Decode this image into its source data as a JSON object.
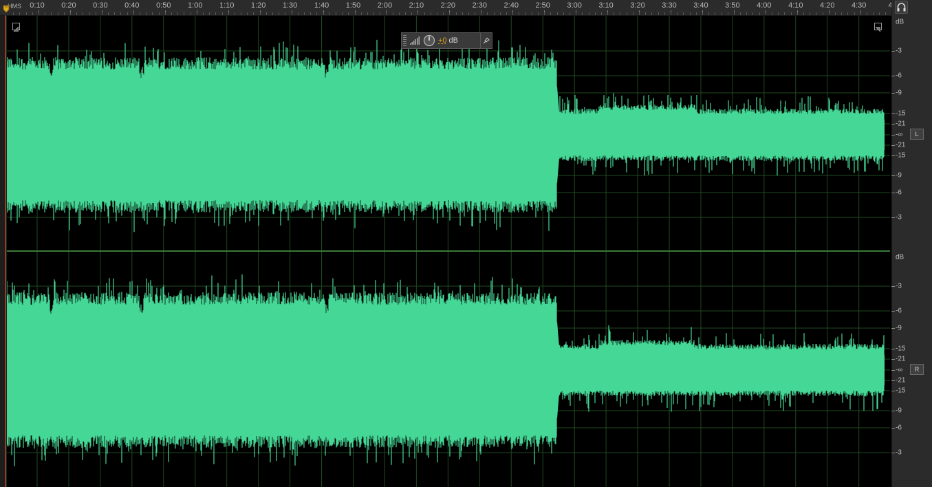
{
  "ruler": {
    "hms_label": "HMS",
    "time_labels": [
      "0:10",
      "0:20",
      "0:30",
      "0:40",
      "0:50",
      "1:00",
      "1:10",
      "1:20",
      "1:30",
      "1:40",
      "1:50",
      "2:00",
      "2:10",
      "2:20",
      "2:30",
      "2:40",
      "2:50",
      "3:00",
      "3:10",
      "3:20",
      "3:30",
      "3:40",
      "3:50",
      "4:00",
      "4:10",
      "4:20",
      "4:30",
      "4"
    ]
  },
  "hud": {
    "value": "+0",
    "unit": "dB"
  },
  "scale": {
    "top_channel": {
      "unit": "dB",
      "labels": [
        "-3",
        "-6",
        "-9",
        "-15",
        "-21",
        "-∞",
        "-21",
        "-15",
        "-9",
        "-6",
        "-3"
      ],
      "badge": "L"
    },
    "bottom_channel": {
      "unit": "dB",
      "labels": [
        "-3",
        "-6",
        "-9",
        "-15",
        "-21",
        "-∞",
        "-21",
        "-15",
        "-9",
        "-6",
        "-3"
      ],
      "badge": "R"
    }
  },
  "colors": {
    "waveform": "#45d796",
    "grid": "#1f4a1f",
    "background": "#000000",
    "divider": "#3a7a3a",
    "hud_value": "#e2a21d"
  },
  "icons": {
    "headphone": "headphones-icon",
    "playhead": "playhead-marker-icon",
    "meter": "level-meter-icon",
    "knob": "gain-knob-icon",
    "pin": "pin-icon",
    "corner_left": "zoom-corner-icon",
    "corner_right": "zoom-corner-icon"
  }
}
